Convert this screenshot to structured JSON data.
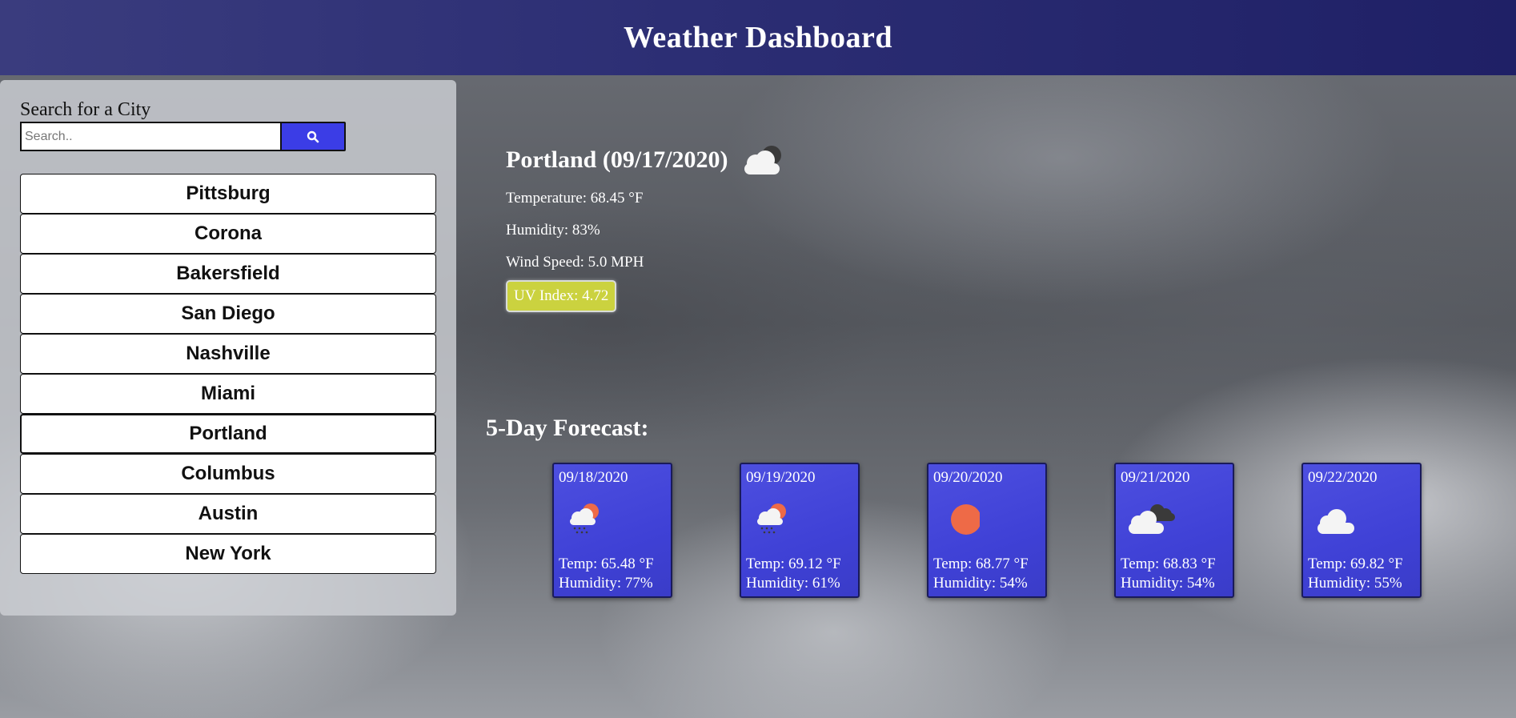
{
  "header": {
    "title": "Weather Dashboard"
  },
  "sidebar": {
    "search_label": "Search for a City",
    "search_placeholder": "Search..",
    "search_value": "",
    "search_icon": "search-icon",
    "cities": [
      "Pittsburg",
      "Corona",
      "Bakersfield",
      "San Diego",
      "Nashville",
      "Miami",
      "Portland",
      "Columbus",
      "Austin",
      "New York"
    ],
    "active_city": "Portland"
  },
  "current": {
    "title": "Portland (09/17/2020)",
    "icon": "partly-cloudy-night-icon",
    "temperature": "Temperature: 68.45 °F",
    "humidity": "Humidity: 83%",
    "wind": "Wind Speed: 5.0 MPH",
    "uv": "UV Index: 4.72",
    "uv_color": "#cbd23f"
  },
  "forecast": {
    "title": "5-Day Forecast:",
    "days": [
      {
        "date": "09/18/2020",
        "icon": "rain-sun-icon",
        "temp": "Temp: 65.48 °F",
        "humidity": "Humidity: 77%"
      },
      {
        "date": "09/19/2020",
        "icon": "rain-sun-icon",
        "temp": "Temp: 69.12 °F",
        "humidity": "Humidity: 61%"
      },
      {
        "date": "09/20/2020",
        "icon": "sun-icon",
        "temp": "Temp: 68.77 °F",
        "humidity": "Humidity: 54%"
      },
      {
        "date": "09/21/2020",
        "icon": "broken-clouds-icon",
        "temp": "Temp: 68.83 °F",
        "humidity": "Humidity: 54%"
      },
      {
        "date": "09/22/2020",
        "icon": "cloud-icon",
        "temp": "Temp: 69.82 °F",
        "humidity": "Humidity: 55%"
      }
    ]
  },
  "colors": {
    "header": "#2c2e74",
    "accent": "#3b3de6",
    "card": "#4446dc",
    "sun": "#ee6a47"
  }
}
